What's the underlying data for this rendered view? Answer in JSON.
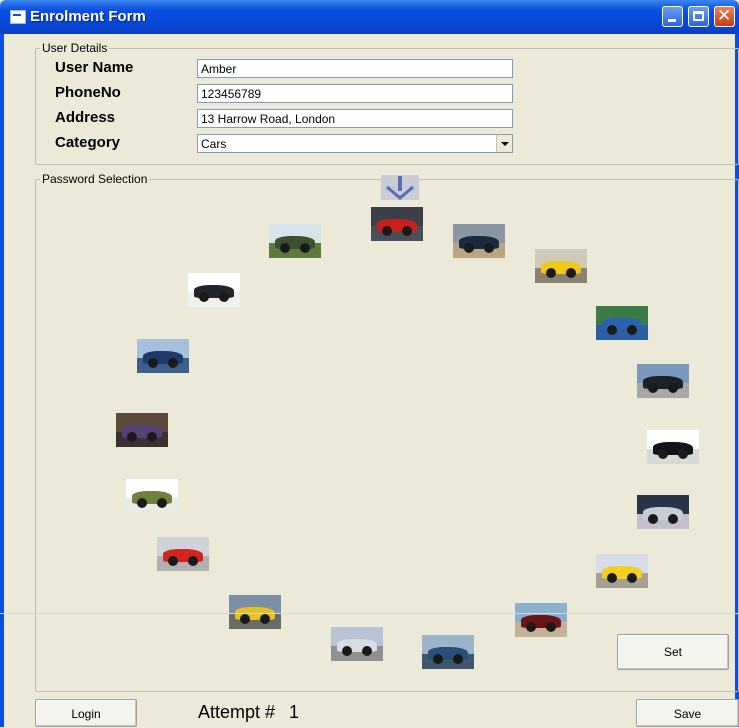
{
  "window": {
    "title": "Enrolment Form"
  },
  "user_details": {
    "legend": "User Details",
    "fields": [
      {
        "label": "User Name",
        "value": "Amber"
      },
      {
        "label": "PhoneNo",
        "value": "123456789"
      },
      {
        "label": "Address",
        "value": "13 Harrow Road, London"
      }
    ],
    "category": {
      "label": "Category",
      "value": "Cars"
    }
  },
  "password_selection": {
    "legend": "Password Selection",
    "pointer_icon": "down-arrow-icon",
    "images": [
      {
        "name": "red-sports-car",
        "sky": "#3a3f48",
        "ground": "#4a4f58",
        "car": "#c8201e"
      },
      {
        "name": "black-striped-car",
        "sky": "#8a96a6",
        "ground": "#b9a582",
        "car": "#1b2b3e"
      },
      {
        "name": "yellow-sports-car",
        "sky": "#cfc9b8",
        "ground": "#8a8270",
        "car": "#f0c818"
      },
      {
        "name": "blue-car-green-scene",
        "sky": "#3b7a48",
        "ground": "#2c5fa0",
        "car": "#2a60b0"
      },
      {
        "name": "black-car-seaside",
        "sky": "#7a98c0",
        "ground": "#a8a8a8",
        "car": "#1e2126"
      },
      {
        "name": "black-roadster",
        "sky": "#ffffff",
        "ground": "#d8d8d8",
        "car": "#121418"
      },
      {
        "name": "silver-car-on-tarmac",
        "sky": "#2a3448",
        "ground": "#c0c0c8",
        "car": "#c8ccd4"
      },
      {
        "name": "yellow-convertible",
        "sky": "#d6dce8",
        "ground": "#a5a094",
        "car": "#f2cf20"
      },
      {
        "name": "dark-red-classic",
        "sky": "#8ab0d0",
        "ground": "#c2b398",
        "car": "#6a1418"
      },
      {
        "name": "blue-car-coast",
        "sky": "#9cb3cc",
        "ground": "#40566e",
        "car": "#2a4e78"
      },
      {
        "name": "silver-suv",
        "sky": "#b8c4d6",
        "ground": "#909090",
        "car": "#d8dce4"
      },
      {
        "name": "yellow-coupe",
        "sky": "#7a8ea6",
        "ground": "#6a6a66",
        "car": "#e8c21c"
      },
      {
        "name": "red-classic-convertible",
        "sky": "#cfd2d8",
        "ground": "#b0b0b0",
        "car": "#d0241c"
      },
      {
        "name": "green-racer-silhouette",
        "sky": "#ffffff",
        "ground": "#e8ebe2",
        "car": "#6f7f3c"
      },
      {
        "name": "purple-show-car",
        "sky": "#5c4a3c",
        "ground": "#3a3030",
        "car": "#5a4078"
      },
      {
        "name": "blue-car-lake",
        "sky": "#a6c0dc",
        "ground": "#3c5f8c",
        "car": "#203a6c"
      },
      {
        "name": "black-pickup-truck",
        "sky": "#ffffff",
        "ground": "#f0f0f0",
        "car": "#22262c"
      },
      {
        "name": "green-vintage-car",
        "sky": "#d8e4ea",
        "ground": "#5c7a3c",
        "car": "#3c5030"
      }
    ]
  },
  "buttons": {
    "set": "Set",
    "login": "Login",
    "save": "Save"
  },
  "attempt": {
    "label": "Attempt #",
    "value": "1"
  }
}
